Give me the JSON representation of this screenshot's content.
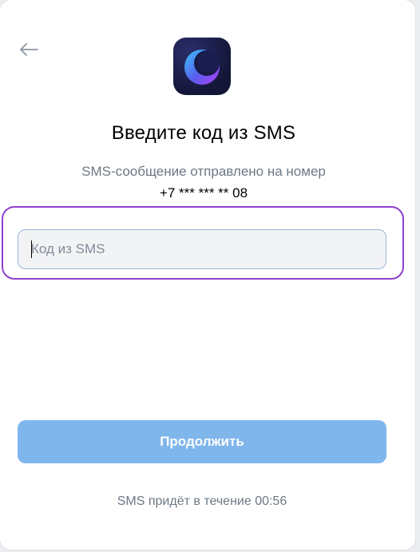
{
  "colors": {
    "accent": "#7fb6ec",
    "highlight_frame": "#8f3fd0",
    "secondary_text": "#6d7885"
  },
  "header": {
    "back_icon": "arrow-left-icon",
    "logo_icon": "app-logo-icon"
  },
  "content": {
    "title": "Введите код из SMS",
    "subtitle": "SMS-сообщение отправлено на номер",
    "phone": "+7 *** *** ** 08"
  },
  "code_field": {
    "placeholder": "Код из SMS",
    "value": ""
  },
  "actions": {
    "continue_label": "Продолжить"
  },
  "footer": {
    "timer_text": "SMS придёт в течение 00:56"
  }
}
